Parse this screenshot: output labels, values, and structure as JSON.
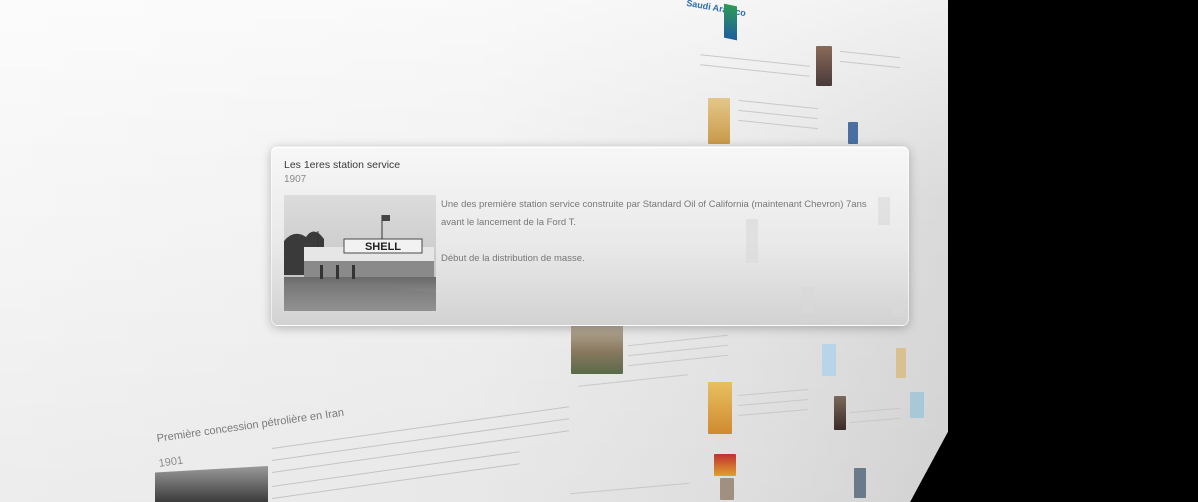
{
  "card": {
    "title": "Les 1eres station service",
    "year": "1907",
    "description_1": "Une des première station service construite par Standard Oil of California (maintenant Chevron) 7ans avant le lancement de la Ford T.",
    "description_2": "Début de la distribution de masse.",
    "photo_sign": "SHELL"
  },
  "background": {
    "logo_text": "Saudi Aramco",
    "timeline_title": "Première concession pétrolière en Iran",
    "timeline_year": "1901"
  }
}
